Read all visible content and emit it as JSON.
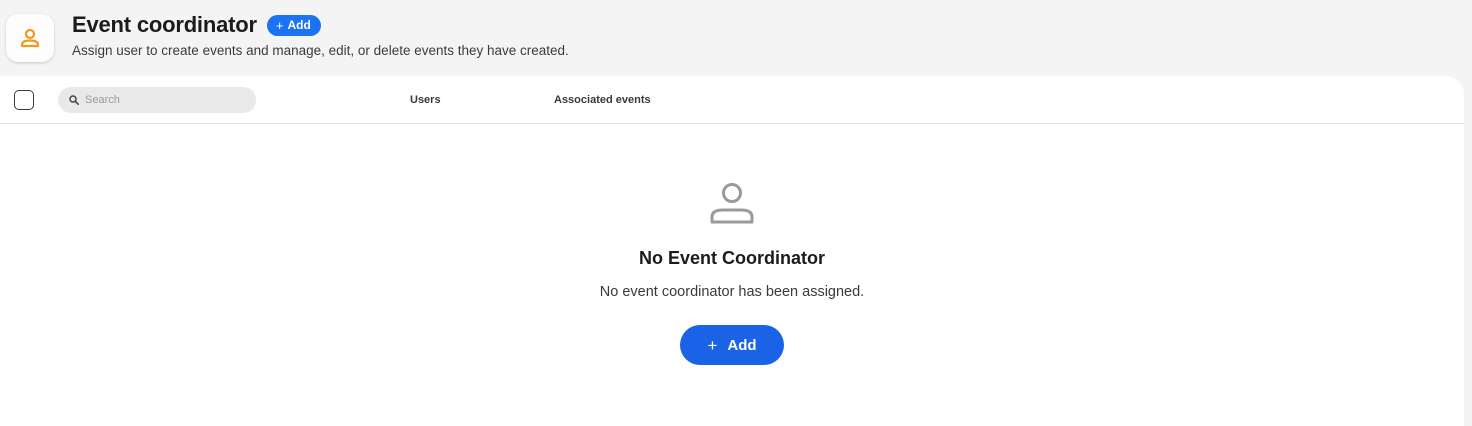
{
  "header": {
    "icon": "user-badge-icon",
    "title": "Event coordinator",
    "add_label": "Add",
    "subtitle": "Assign user to create events and manage, edit, or delete events they have created."
  },
  "table": {
    "search_placeholder": "Search",
    "columns": [
      "Users",
      "Associated events"
    ]
  },
  "empty_state": {
    "icon": "person-icon",
    "title": "No Event Coordinator",
    "description": "No event coordinator has been assigned.",
    "add_label": "Add"
  },
  "colors": {
    "accent": "#1a62e6",
    "pill": "#1a73f0",
    "icon_orange": "#f39a1c",
    "background": "#f4f4f4"
  }
}
